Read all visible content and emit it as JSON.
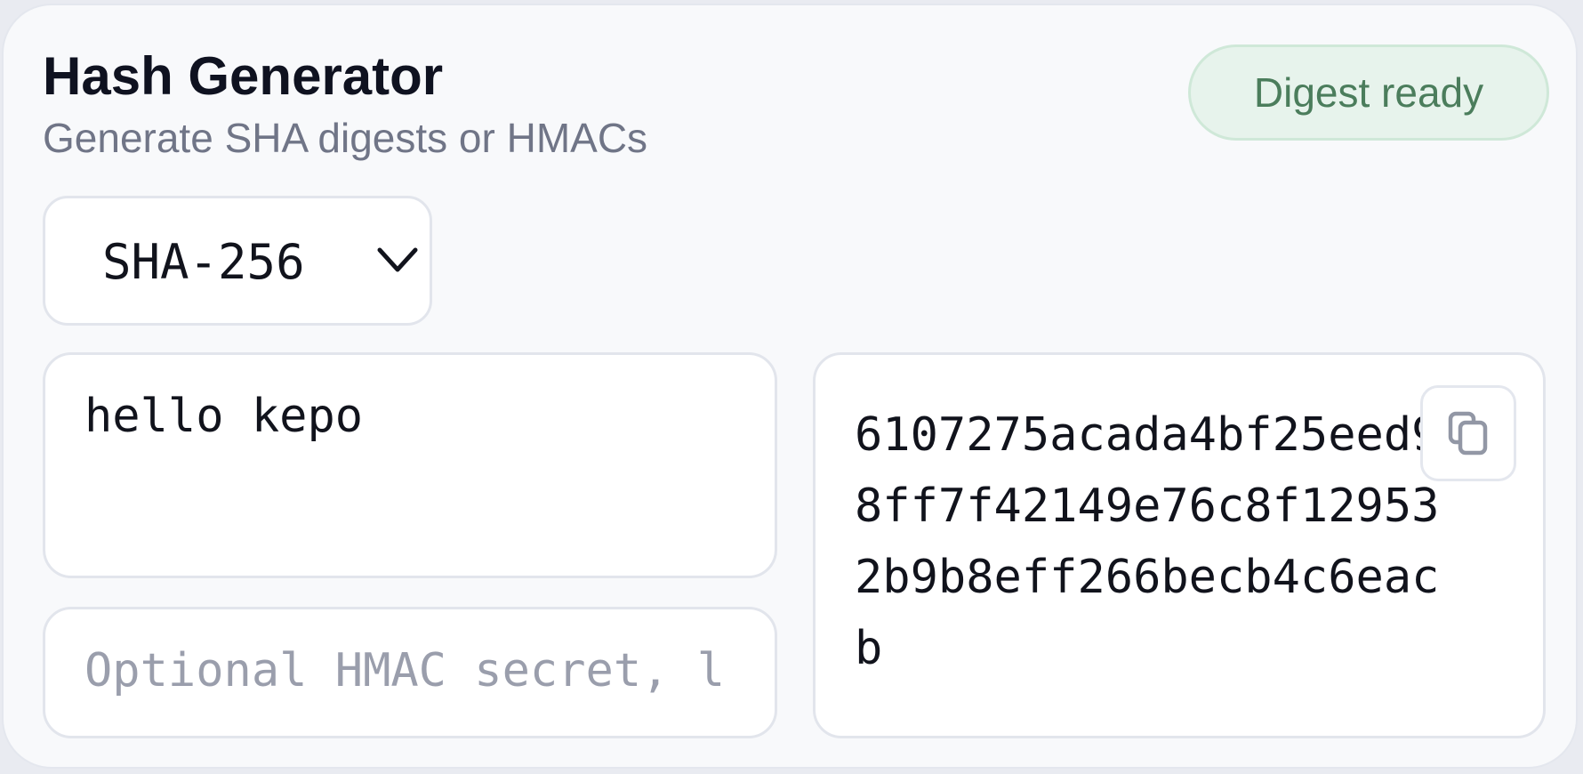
{
  "header": {
    "title": "Hash Generator",
    "subtitle": "Generate SHA digests or HMACs"
  },
  "status": {
    "label": "Digest ready",
    "color": "#4b7d5c",
    "background": "#e7f3ec"
  },
  "algorithm": {
    "selected": "SHA-256",
    "icon": "chevron-down-icon"
  },
  "input": {
    "value": "hello kepo"
  },
  "secret": {
    "value": "",
    "placeholder": "Optional HMAC secret, leave empty for plain hash"
  },
  "output": {
    "digest": "6107275acada4bf25eed98ff7f42149e76c8f129532b9b8eff266becb4c6eacb",
    "copy_icon": "copy-icon"
  }
}
